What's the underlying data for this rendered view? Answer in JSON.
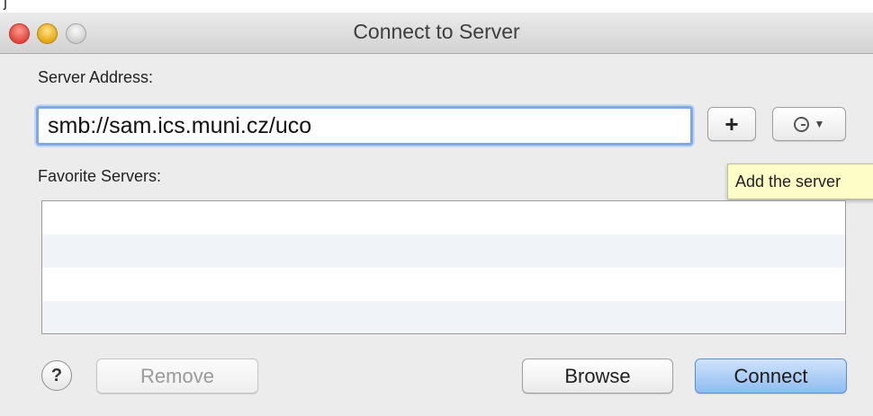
{
  "window": {
    "title": "Connect to Server",
    "top_fragment": "j"
  },
  "labels": {
    "server_address": "Server Address:",
    "favorite_servers": "Favorite Servers:"
  },
  "address": {
    "value": "smb://sam.ics.muni.cz/uco"
  },
  "toolbar": {
    "add_label": "+"
  },
  "tooltip": {
    "text": "Add the server"
  },
  "favorites": {
    "rows": [
      "",
      "",
      "",
      ""
    ]
  },
  "buttons": {
    "help_label": "?",
    "remove_label": "Remove",
    "browse_label": "Browse",
    "connect_label": "Connect"
  },
  "icons": {
    "history": "clock-icon",
    "history_menu": "caret-down-icon"
  },
  "colors": {
    "focus_ring": "#7fa9e0",
    "connect_button": "#8fbcf0",
    "tooltip_bg": "#fdfdc8"
  }
}
